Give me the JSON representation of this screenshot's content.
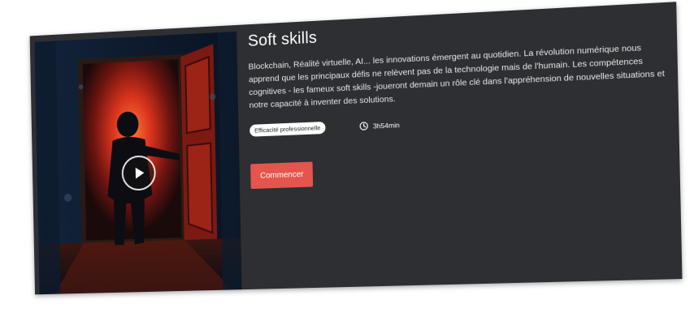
{
  "course": {
    "title": "Soft skills",
    "description": "Blockchain, Réalité virtuelle, AI... les innovations émergent au quotidien. La révolution numérique nous apprend que les principaux défis ne relèvent pas de la technologie mais de l'humain. Les compétences cognitives - les fameux soft skills -joueront demain un rôle clé dans l'appréhension de nouvelles situations et notre capacité à inventer des solutions.",
    "category_tag": "Efficacité professionnelle",
    "duration": "3h54min",
    "start_label": "Commencer"
  },
  "media": {
    "play_icon": "play-icon",
    "clock_icon": "clock-icon"
  },
  "colors": {
    "card_bg": "#2d2f32",
    "accent": "#e5544d",
    "tag_bg": "#ffffff"
  }
}
